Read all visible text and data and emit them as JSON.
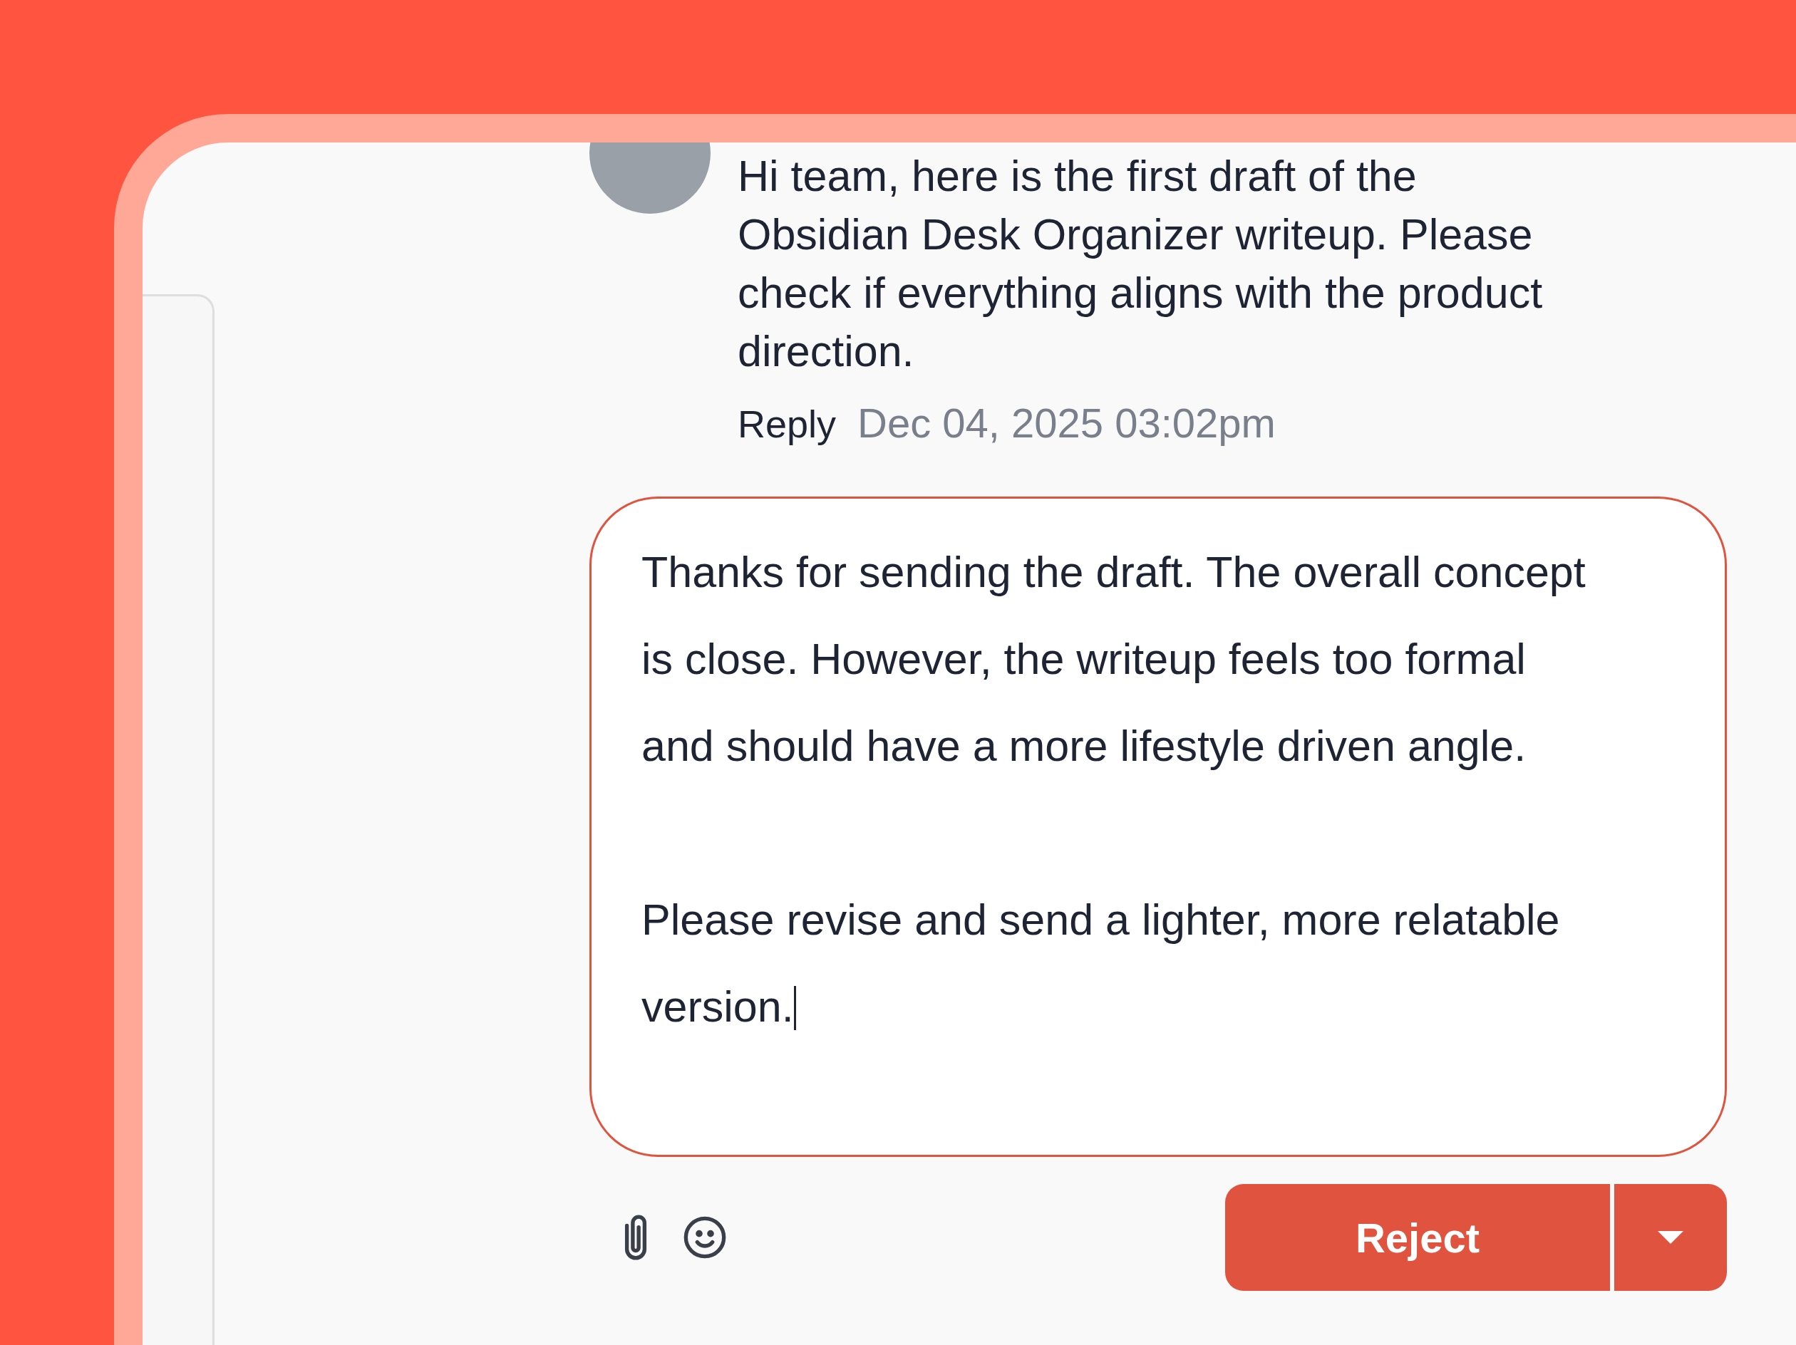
{
  "message": {
    "text": "Hi team, here is the first draft of the Obsidian Desk Organizer writeup. Please check if everything aligns with the product direction.",
    "reply_label": "Reply",
    "timestamp": "Dec 04, 2025 03:02pm"
  },
  "reply_field": {
    "value": "Thanks for sending the draft. The overall concept is close. However, the writeup feels too formal and should have a more lifestyle driven angle.\n\nPlease revise and send a lighter, more relatable version."
  },
  "action_button": {
    "label": "Reject"
  }
}
